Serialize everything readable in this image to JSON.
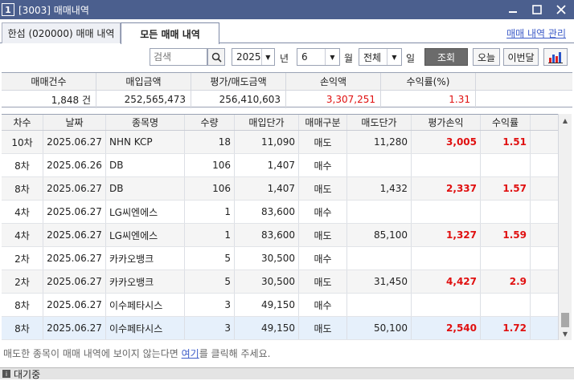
{
  "window": {
    "number": "1",
    "title": "[3003] 매매내역",
    "minimize_icon": "minimize-icon",
    "maximize_icon": "maximize-icon",
    "close_icon": "close-icon"
  },
  "tabs": [
    {
      "label": "한섬 (020000) 매매 내역",
      "active": false
    },
    {
      "label": "모든 매매 내역",
      "active": true
    }
  ],
  "manage_link": "매매 내역 관리",
  "filters": {
    "search_placeholder": "검색",
    "year": "2025",
    "year_label": "년",
    "month": "6",
    "month_label": "월",
    "day": "전체",
    "day_label": "일",
    "query_label": "조회",
    "today_label": "오늘",
    "this_month_label": "이번달",
    "chart_icon": "bar-chart-icon"
  },
  "summary": {
    "headers": [
      "매매건수",
      "매입금액",
      "평가/매도금액",
      "손익액",
      "수익률(%)"
    ],
    "values": [
      "1,848 건",
      "252,565,473",
      "256,410,603",
      "3,307,251",
      "1.31"
    ]
  },
  "grid": {
    "headers": [
      "차수",
      "날짜",
      "종목명",
      "수량",
      "매입단가",
      "매매구분",
      "매도단가",
      "평가손익",
      "수익률"
    ],
    "rows": [
      {
        "round": "10차",
        "date": "2025.06.27",
        "name": "NHN KCP",
        "qty": "18",
        "buy_price": "11,090",
        "type": "매도",
        "sell_price": "11,280",
        "pnl": "3,005",
        "rate": "1.51"
      },
      {
        "round": "8차",
        "date": "2025.06.26",
        "name": "DB",
        "qty": "106",
        "buy_price": "1,407",
        "type": "매수",
        "sell_price": "",
        "pnl": "",
        "rate": ""
      },
      {
        "round": "8차",
        "date": "2025.06.27",
        "name": "DB",
        "qty": "106",
        "buy_price": "1,407",
        "type": "매도",
        "sell_price": "1,432",
        "pnl": "2,337",
        "rate": "1.57"
      },
      {
        "round": "4차",
        "date": "2025.06.27",
        "name": "LG씨엔에스",
        "qty": "1",
        "buy_price": "83,600",
        "type": "매수",
        "sell_price": "",
        "pnl": "",
        "rate": ""
      },
      {
        "round": "4차",
        "date": "2025.06.27",
        "name": "LG씨엔에스",
        "qty": "1",
        "buy_price": "83,600",
        "type": "매도",
        "sell_price": "85,100",
        "pnl": "1,327",
        "rate": "1.59"
      },
      {
        "round": "2차",
        "date": "2025.06.27",
        "name": "카카오뱅크",
        "qty": "5",
        "buy_price": "30,500",
        "type": "매수",
        "sell_price": "",
        "pnl": "",
        "rate": ""
      },
      {
        "round": "2차",
        "date": "2025.06.27",
        "name": "카카오뱅크",
        "qty": "5",
        "buy_price": "30,500",
        "type": "매도",
        "sell_price": "31,450",
        "pnl": "4,427",
        "rate": "2.9"
      },
      {
        "round": "8차",
        "date": "2025.06.27",
        "name": "이수페타시스",
        "qty": "3",
        "buy_price": "49,150",
        "type": "매수",
        "sell_price": "",
        "pnl": "",
        "rate": ""
      },
      {
        "round": "8차",
        "date": "2025.06.27",
        "name": "이수페타시스",
        "qty": "3",
        "buy_price": "49,150",
        "type": "매도",
        "sell_price": "50,100",
        "pnl": "2,540",
        "rate": "1.72"
      }
    ]
  },
  "footnote": {
    "before": "매도한 종목이 매매 내역에 보이지 않는다면 ",
    "link": "여기",
    "after": "를 클릭해 주세요."
  },
  "status": {
    "icon": "info-icon",
    "text": "대기중"
  },
  "colors": {
    "titlebar": "#4b5f8e",
    "profit": "#e01010",
    "link": "#3c5bc8",
    "selected_row": "#e6f0fb"
  }
}
